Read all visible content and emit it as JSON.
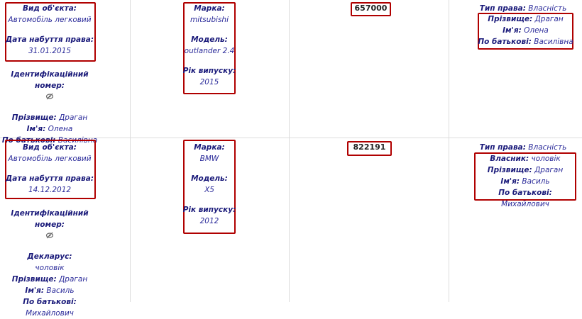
{
  "rows": [
    {
      "object_type_label": "Вид об'єкта:",
      "object_type_value": "Автомобіль легковий",
      "acquired_label": "Дата набуття права:",
      "acquired_value": "31.01.2015",
      "id_label": "Ідентифікаційний номер:",
      "surname_label": "Прізвище:",
      "surname_value": "Драган",
      "name_label": "Ім'я:",
      "name_value": "Олена",
      "patronymic_label": "По батькові:",
      "patronymic_value": "Василівна",
      "brand_label": "Марка:",
      "brand_value": "mitsubishi",
      "model_label": "Модель:",
      "model_value": "outlander 2.4",
      "year_label": "Рік випуску:",
      "year_value": "2015",
      "price": "657000",
      "right_type_label": "Тип права:",
      "right_type_value": "Власність",
      "owner_surname_label": "Прізвище:",
      "owner_surname_value": "Драган",
      "owner_name_label": "Ім'я:",
      "owner_name_value": "Олена",
      "owner_patronymic_label": "По батькові:",
      "owner_patronymic_value": "Василівна"
    },
    {
      "object_type_label": "Вид об'єкта:",
      "object_type_value": "Автомобіль легковий",
      "acquired_label": "Дата набуття права:",
      "acquired_value": "14.12.2012",
      "id_label": "Ідентифікаційний номер:",
      "declarant_label": "Декларус:",
      "declarant_value": "чоловік",
      "surname_label": "Прізвище:",
      "surname_value": "Драган",
      "name_label": "Ім'я:",
      "name_value": "Василь",
      "patronymic_label": "По батькові:",
      "patronymic_value": "Михайлович",
      "brand_label": "Марка:",
      "brand_value": "BMW",
      "model_label": "Модель:",
      "model_value": "X5",
      "year_label": "Рік випуску:",
      "year_value": "2012",
      "price": "822191",
      "right_type_label": "Тип права:",
      "right_type_value": "Власність",
      "owner_label": "Власник:",
      "owner_value": "чоловік",
      "owner_surname_label": "Прізвище:",
      "owner_surname_value": "Драган",
      "owner_name_label": "Ім'я:",
      "owner_name_value": "Василь",
      "owner_patronymic_label": "По батькові:",
      "owner_patronymic_value": "Михайлович"
    }
  ],
  "icons": {
    "hidden_id": "eye-slash-icon"
  },
  "colors": {
    "highlight_border": "#b00000",
    "text_blue": "#1a1a7a"
  }
}
